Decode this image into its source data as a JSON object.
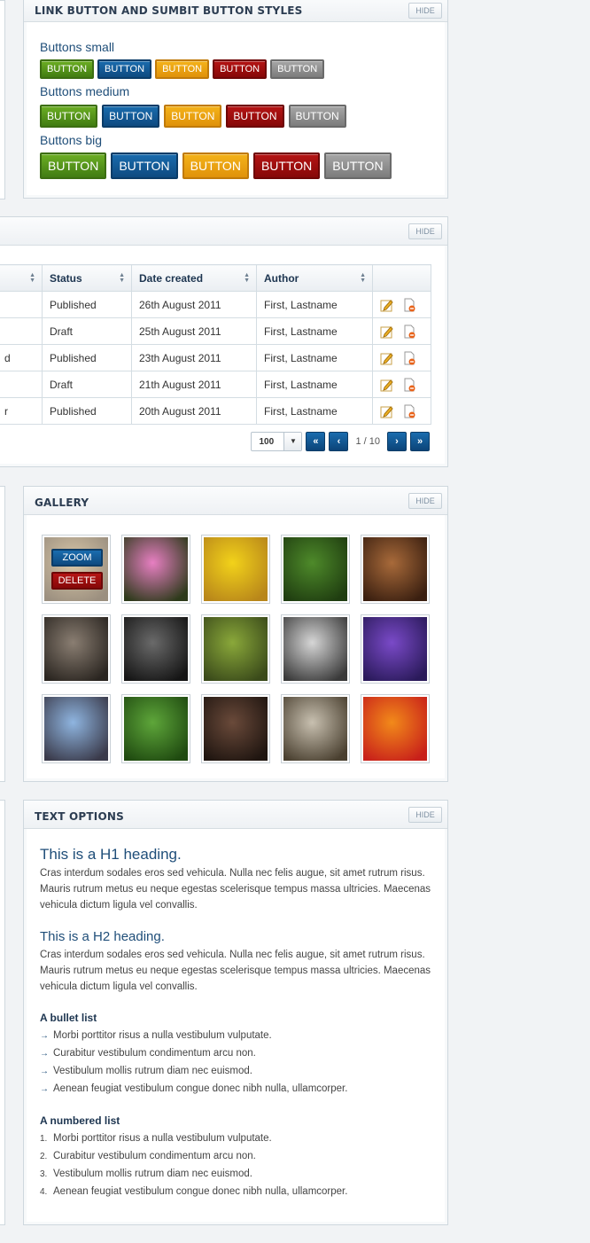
{
  "buttons_panel": {
    "title": "LINK BUTTON AND SUMBIT BUTTON STYLES",
    "hide_label": "HIDE",
    "groups": [
      {
        "label": "Buttons small",
        "buttons": [
          "BUTTON",
          "BUTTON",
          "BUTTON",
          "BUTTON",
          "BUTTON"
        ]
      },
      {
        "label": "Buttons medium",
        "buttons": [
          "BUTTON",
          "BUTTON",
          "BUTTON",
          "BUTTON",
          "BUTTON"
        ]
      },
      {
        "label": "Buttons big",
        "buttons": [
          "BUTTON",
          "BUTTON",
          "BUTTON",
          "BUTTON",
          "BUTTON"
        ]
      }
    ],
    "button_colors": {
      "green": "#4f8f16",
      "blue": "#12599a",
      "orange": "#eda413",
      "red": "#9e0c0c",
      "gray": "#8e8e8e"
    }
  },
  "table_panel": {
    "hide_label": "HIDE",
    "columns": [
      "",
      "Status",
      "Date created",
      "Author",
      ""
    ],
    "rows": [
      {
        "title": "",
        "status": "Published",
        "date": "26th August 2011",
        "author": "First, Lastname"
      },
      {
        "title": "",
        "status": "Draft",
        "date": "25th August 2011",
        "author": "First, Lastname"
      },
      {
        "title": "d",
        "status": "Published",
        "date": "23th August 2011",
        "author": "First, Lastname"
      },
      {
        "title": "",
        "status": "Draft",
        "date": "21th August 2011",
        "author": "First, Lastname"
      },
      {
        "title": "r",
        "status": "Published",
        "date": "20th August 2011",
        "author": "First, Lastname"
      }
    ],
    "pager": {
      "per_page": "100",
      "first": "«",
      "prev": "‹",
      "info": "1 / 10",
      "next": "›",
      "last": "»"
    }
  },
  "gallery_panel": {
    "title": "GALLERY",
    "hide_label": "HIDE",
    "zoom_label": "ZOOM",
    "delete_label": "DELETE",
    "images": [
      {
        "subject": "coins",
        "colors": [
          "#d9c7a8",
          "#9b8f7f"
        ]
      },
      {
        "subject": "pink-flower",
        "colors": [
          "#e77fc2",
          "#2d3a1a"
        ]
      },
      {
        "subject": "sunflower",
        "colors": [
          "#f2d21a",
          "#b8861a"
        ]
      },
      {
        "subject": "butterfly",
        "colors": [
          "#4e8a2a",
          "#1f3d10"
        ]
      },
      {
        "subject": "interior-room",
        "colors": [
          "#a86a3a",
          "#3a1f10"
        ]
      },
      {
        "subject": "stones",
        "colors": [
          "#8a7e72",
          "#2a2520"
        ]
      },
      {
        "subject": "corridor",
        "colors": [
          "#6a6a6a",
          "#151515"
        ]
      },
      {
        "subject": "autumn-road",
        "colors": [
          "#8aa83a",
          "#3a4a1a"
        ]
      },
      {
        "subject": "keyboard",
        "colors": [
          "#d6d6d6",
          "#3a3a3a"
        ]
      },
      {
        "subject": "purple-lake",
        "colors": [
          "#7a4ac8",
          "#2a1a5a"
        ]
      },
      {
        "subject": "tower",
        "colors": [
          "#8fb5e0",
          "#3a3a4a"
        ]
      },
      {
        "subject": "parrot",
        "colors": [
          "#5ea63a",
          "#1f4a10"
        ]
      },
      {
        "subject": "rusty-chain",
        "colors": [
          "#6a4a3a",
          "#1f1510"
        ]
      },
      {
        "subject": "stone-stairs",
        "colors": [
          "#c8c0b0",
          "#4a4030"
        ]
      },
      {
        "subject": "citrus",
        "colors": [
          "#f28a1a",
          "#c8201a"
        ]
      }
    ]
  },
  "text_panel": {
    "title": "TEXT OPTIONS",
    "hide_label": "HIDE",
    "h1": "This is a H1 heading.",
    "h1_paragraph": "Cras interdum sodales eros sed vehicula. Nulla nec felis augue, sit amet rutrum risus. Mauris rutrum metus eu neque egestas scelerisque tempus massa ultricies. Maecenas vehicula dictum ligula vel convallis.",
    "h2": "This is a H2 heading.",
    "h2_paragraph": "Cras interdum sodales eros sed vehicula. Nulla nec felis augue, sit amet rutrum risus. Mauris rutrum metus eu neque egestas scelerisque tempus massa ultricies. Maecenas vehicula dictum ligula vel convallis.",
    "bullet_title": "A bullet list",
    "bullets": [
      "Morbi porttitor risus a nulla vestibulum vulputate.",
      "Curabitur vestibulum condimentum arcu non.",
      "Vestibulum mollis rutrum diam nec euismod.",
      "Aenean feugiat vestibulum congue donec nibh nulla, ullamcorper."
    ],
    "numbered_title": "A numbered list",
    "numbered": [
      "Morbi porttitor risus a nulla vestibulum vulputate.",
      "Curabitur vestibulum condimentum arcu non.",
      "Vestibulum mollis rutrum diam nec euismod.",
      "Aenean feugiat vestibulum congue donec nibh nulla, ullamcorper."
    ],
    "numbers": [
      "1.",
      "2.",
      "3.",
      "4."
    ],
    "bullet_mark": "→"
  }
}
